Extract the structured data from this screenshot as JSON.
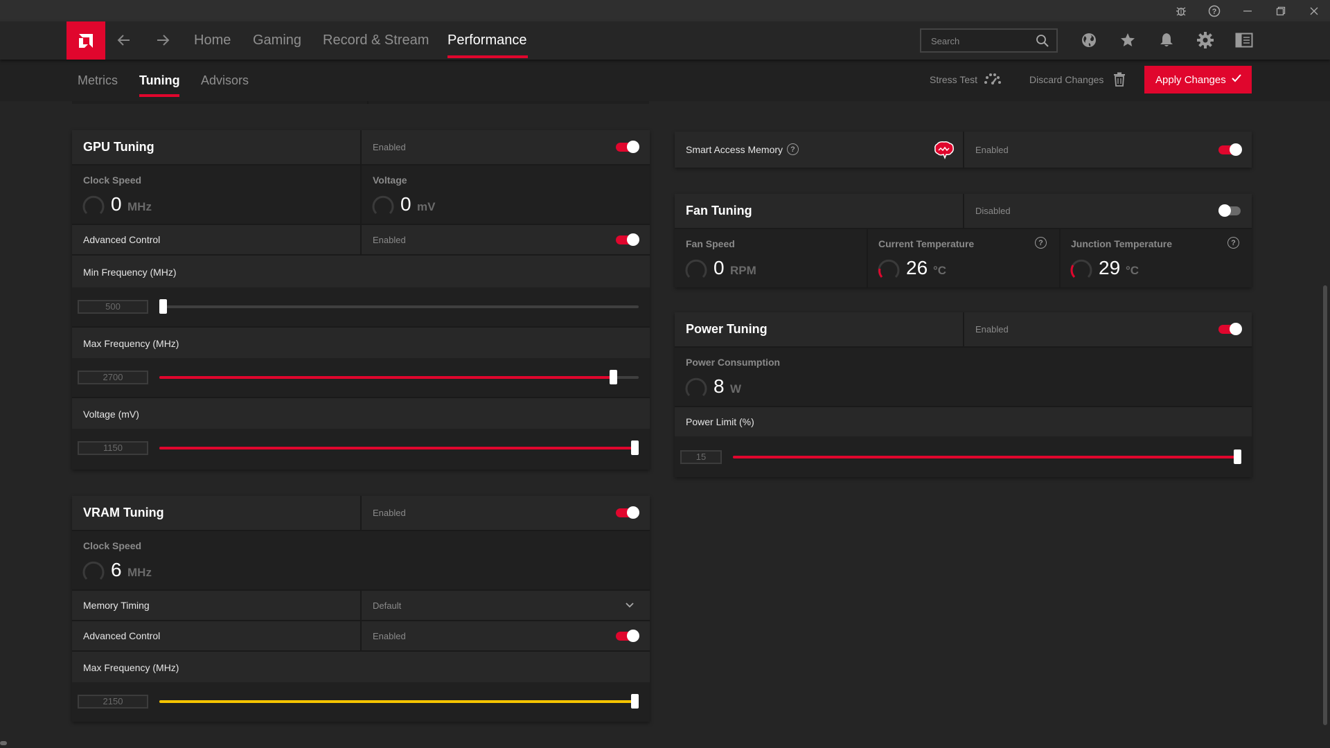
{
  "titlebar": {
    "icons": [
      "bug-icon",
      "help-icon",
      "minimize-icon",
      "restore-icon",
      "close-icon"
    ]
  },
  "nav": {
    "back_icon": "arrow-left-icon",
    "forward_icon": "arrow-right-icon",
    "items": [
      {
        "label": "Home",
        "active": false
      },
      {
        "label": "Gaming",
        "active": false
      },
      {
        "label": "Record & Stream",
        "active": false
      },
      {
        "label": "Performance",
        "active": true
      }
    ],
    "search_placeholder": "Search",
    "right_icons": [
      "globe-icon",
      "star-icon",
      "bell-icon",
      "gear-icon",
      "sidebar-icon"
    ]
  },
  "subnav": {
    "tabs": [
      {
        "label": "Metrics",
        "active": false
      },
      {
        "label": "Tuning",
        "active": true
      },
      {
        "label": "Advisors",
        "active": false
      }
    ],
    "stress_test": "Stress Test",
    "discard_changes": "Discard Changes",
    "apply_changes": "Apply Changes"
  },
  "colors": {
    "accent": "#e0062d",
    "vram_slider": "#f5c400",
    "toggle_off": "#6a6a6a"
  },
  "gpu_tuning": {
    "title": "GPU Tuning",
    "state": "Enabled",
    "enabled": true,
    "clock_speed_label": "Clock Speed",
    "clock_speed_value": "0",
    "clock_speed_unit": "MHz",
    "voltage_label": "Voltage",
    "voltage_value": "0",
    "voltage_unit": "mV",
    "advanced_control_label": "Advanced Control",
    "advanced_control_state": "Enabled",
    "advanced_control_enabled": true,
    "min_freq_label": "Min Frequency (MHz)",
    "min_freq_value": "500",
    "min_freq_fraction": 0.0,
    "max_freq_label": "Max Frequency (MHz)",
    "max_freq_value": "2700",
    "max_freq_fraction": 0.955,
    "voltage_mv_label": "Voltage (mV)",
    "voltage_mv_value": "1150",
    "voltage_mv_fraction": 1.0
  },
  "vram_tuning": {
    "title": "VRAM Tuning",
    "state": "Enabled",
    "enabled": true,
    "clock_speed_label": "Clock Speed",
    "clock_speed_value": "6",
    "clock_speed_unit": "MHz",
    "memory_timing_label": "Memory Timing",
    "memory_timing_value": "Default",
    "advanced_control_label": "Advanced Control",
    "advanced_control_state": "Enabled",
    "advanced_control_enabled": true,
    "max_freq_label": "Max Frequency (MHz)",
    "max_freq_value": "2150",
    "max_freq_fraction": 1.0
  },
  "smart_access_memory": {
    "label": "Smart Access Memory",
    "icon": "brain-icon",
    "state": "Enabled",
    "enabled": true
  },
  "fan_tuning": {
    "title": "Fan Tuning",
    "state": "Disabled",
    "enabled": false,
    "fan_speed_label": "Fan Speed",
    "fan_speed_value": "0",
    "fan_speed_unit": "RPM",
    "current_temp_label": "Current Temperature",
    "current_temp_value": "26",
    "current_temp_unit": "°C",
    "junction_temp_label": "Junction Temperature",
    "junction_temp_value": "29",
    "junction_temp_unit": "°C"
  },
  "power_tuning": {
    "title": "Power Tuning",
    "state": "Enabled",
    "enabled": true,
    "power_consumption_label": "Power Consumption",
    "power_consumption_value": "8",
    "power_consumption_unit": "W",
    "power_limit_label": "Power Limit (%)",
    "power_limit_value": "15",
    "power_limit_fraction": 1.0
  }
}
